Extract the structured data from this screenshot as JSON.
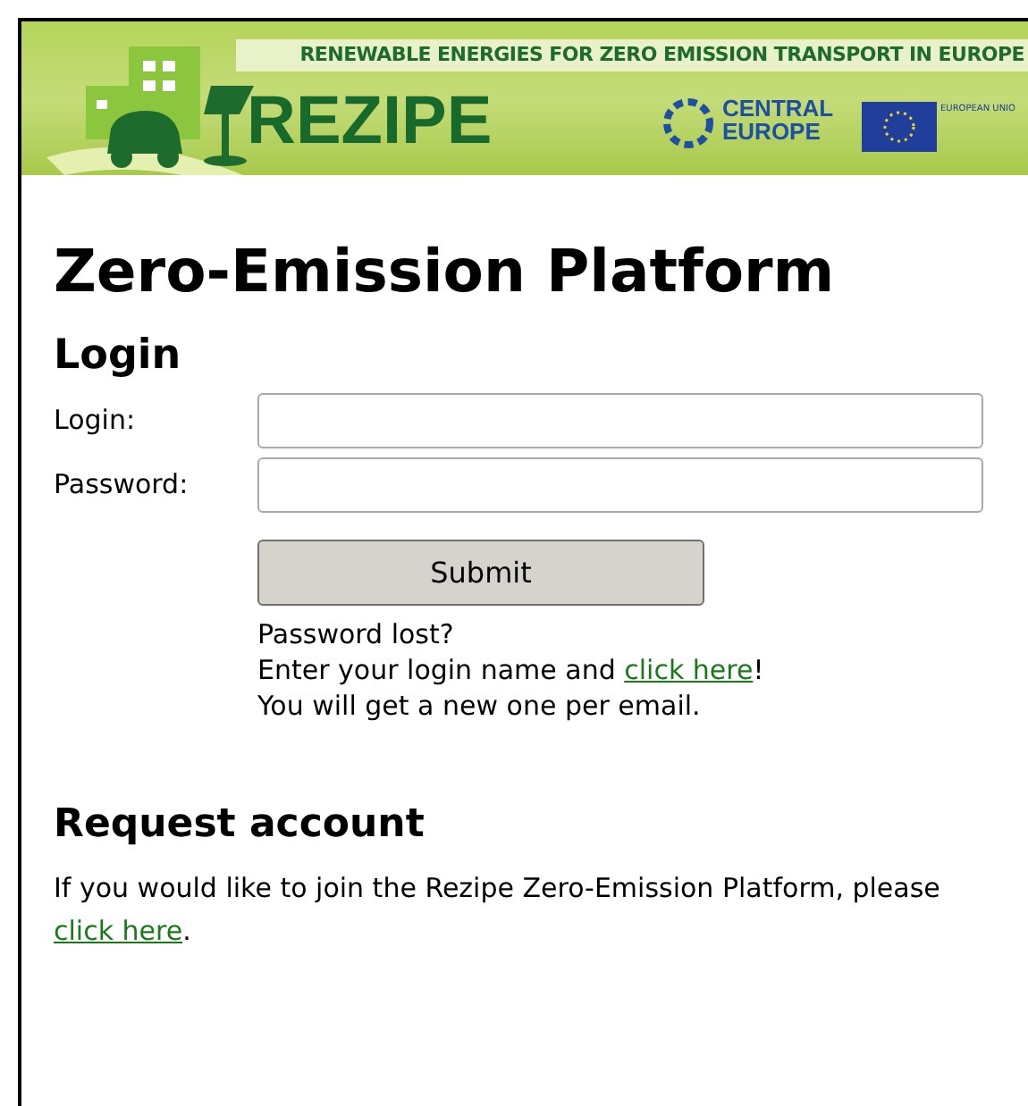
{
  "header": {
    "tagline": "RENEWABLE ENERGIES FOR ZERO EMISSION TRANSPORT IN EUROPE",
    "logo": "REZIPE",
    "partner_logo": [
      "CENTRAL",
      "EUROPE"
    ],
    "eu_label": "EUROPEAN UNIO"
  },
  "title": "Zero-Emission Platform",
  "login": {
    "heading": "Login",
    "fields": [
      {
        "label": "Login:"
      },
      {
        "label": "Password:"
      }
    ],
    "submit": "Submit",
    "lost": "Password lost?",
    "instruction": {
      "before": "Enter your login name and ",
      "link": "click here",
      "after": "!"
    },
    "note": "You will get a new one per email."
  },
  "request": {
    "heading": "Request account",
    "text": {
      "before": "If you would like to join the Rezipe Zero-Emission Platform, please ",
      "link": "click here",
      "after": "."
    }
  }
}
